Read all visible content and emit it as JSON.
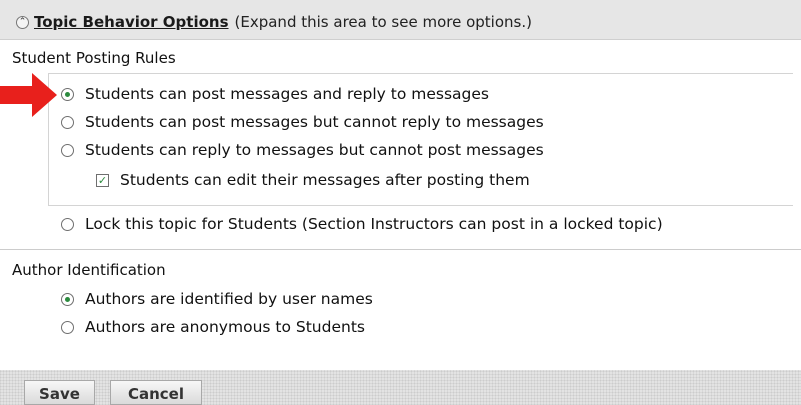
{
  "header": {
    "title": "Topic Behavior Options",
    "note": "(Expand this area to see more options.)",
    "collapse_icon_glyph": "⌃"
  },
  "student_posting": {
    "label": "Student Posting Rules",
    "options": [
      {
        "label": "Students can post messages and reply to messages",
        "checked": true
      },
      {
        "label": "Students can post messages but cannot reply to messages",
        "checked": false
      },
      {
        "label": "Students can reply to messages but cannot post messages",
        "checked": false
      }
    ],
    "edit_checkbox": {
      "label": "Students can edit their messages after posting them",
      "checked": true
    },
    "lock_option": {
      "label": "Lock this topic for Students (Section Instructors can post in a locked topic)",
      "checked": false
    }
  },
  "author_identification": {
    "label": "Author Identification",
    "options": [
      {
        "label": "Authors are identified by user names",
        "checked": true
      },
      {
        "label": "Authors are anonymous to Students",
        "checked": false
      }
    ]
  },
  "buttons": {
    "save": "Save",
    "cancel": "Cancel"
  },
  "colors": {
    "arrow": "#e8201c",
    "header_bg": "#e6e6e6",
    "radio_dot": "#2b8a3e"
  }
}
